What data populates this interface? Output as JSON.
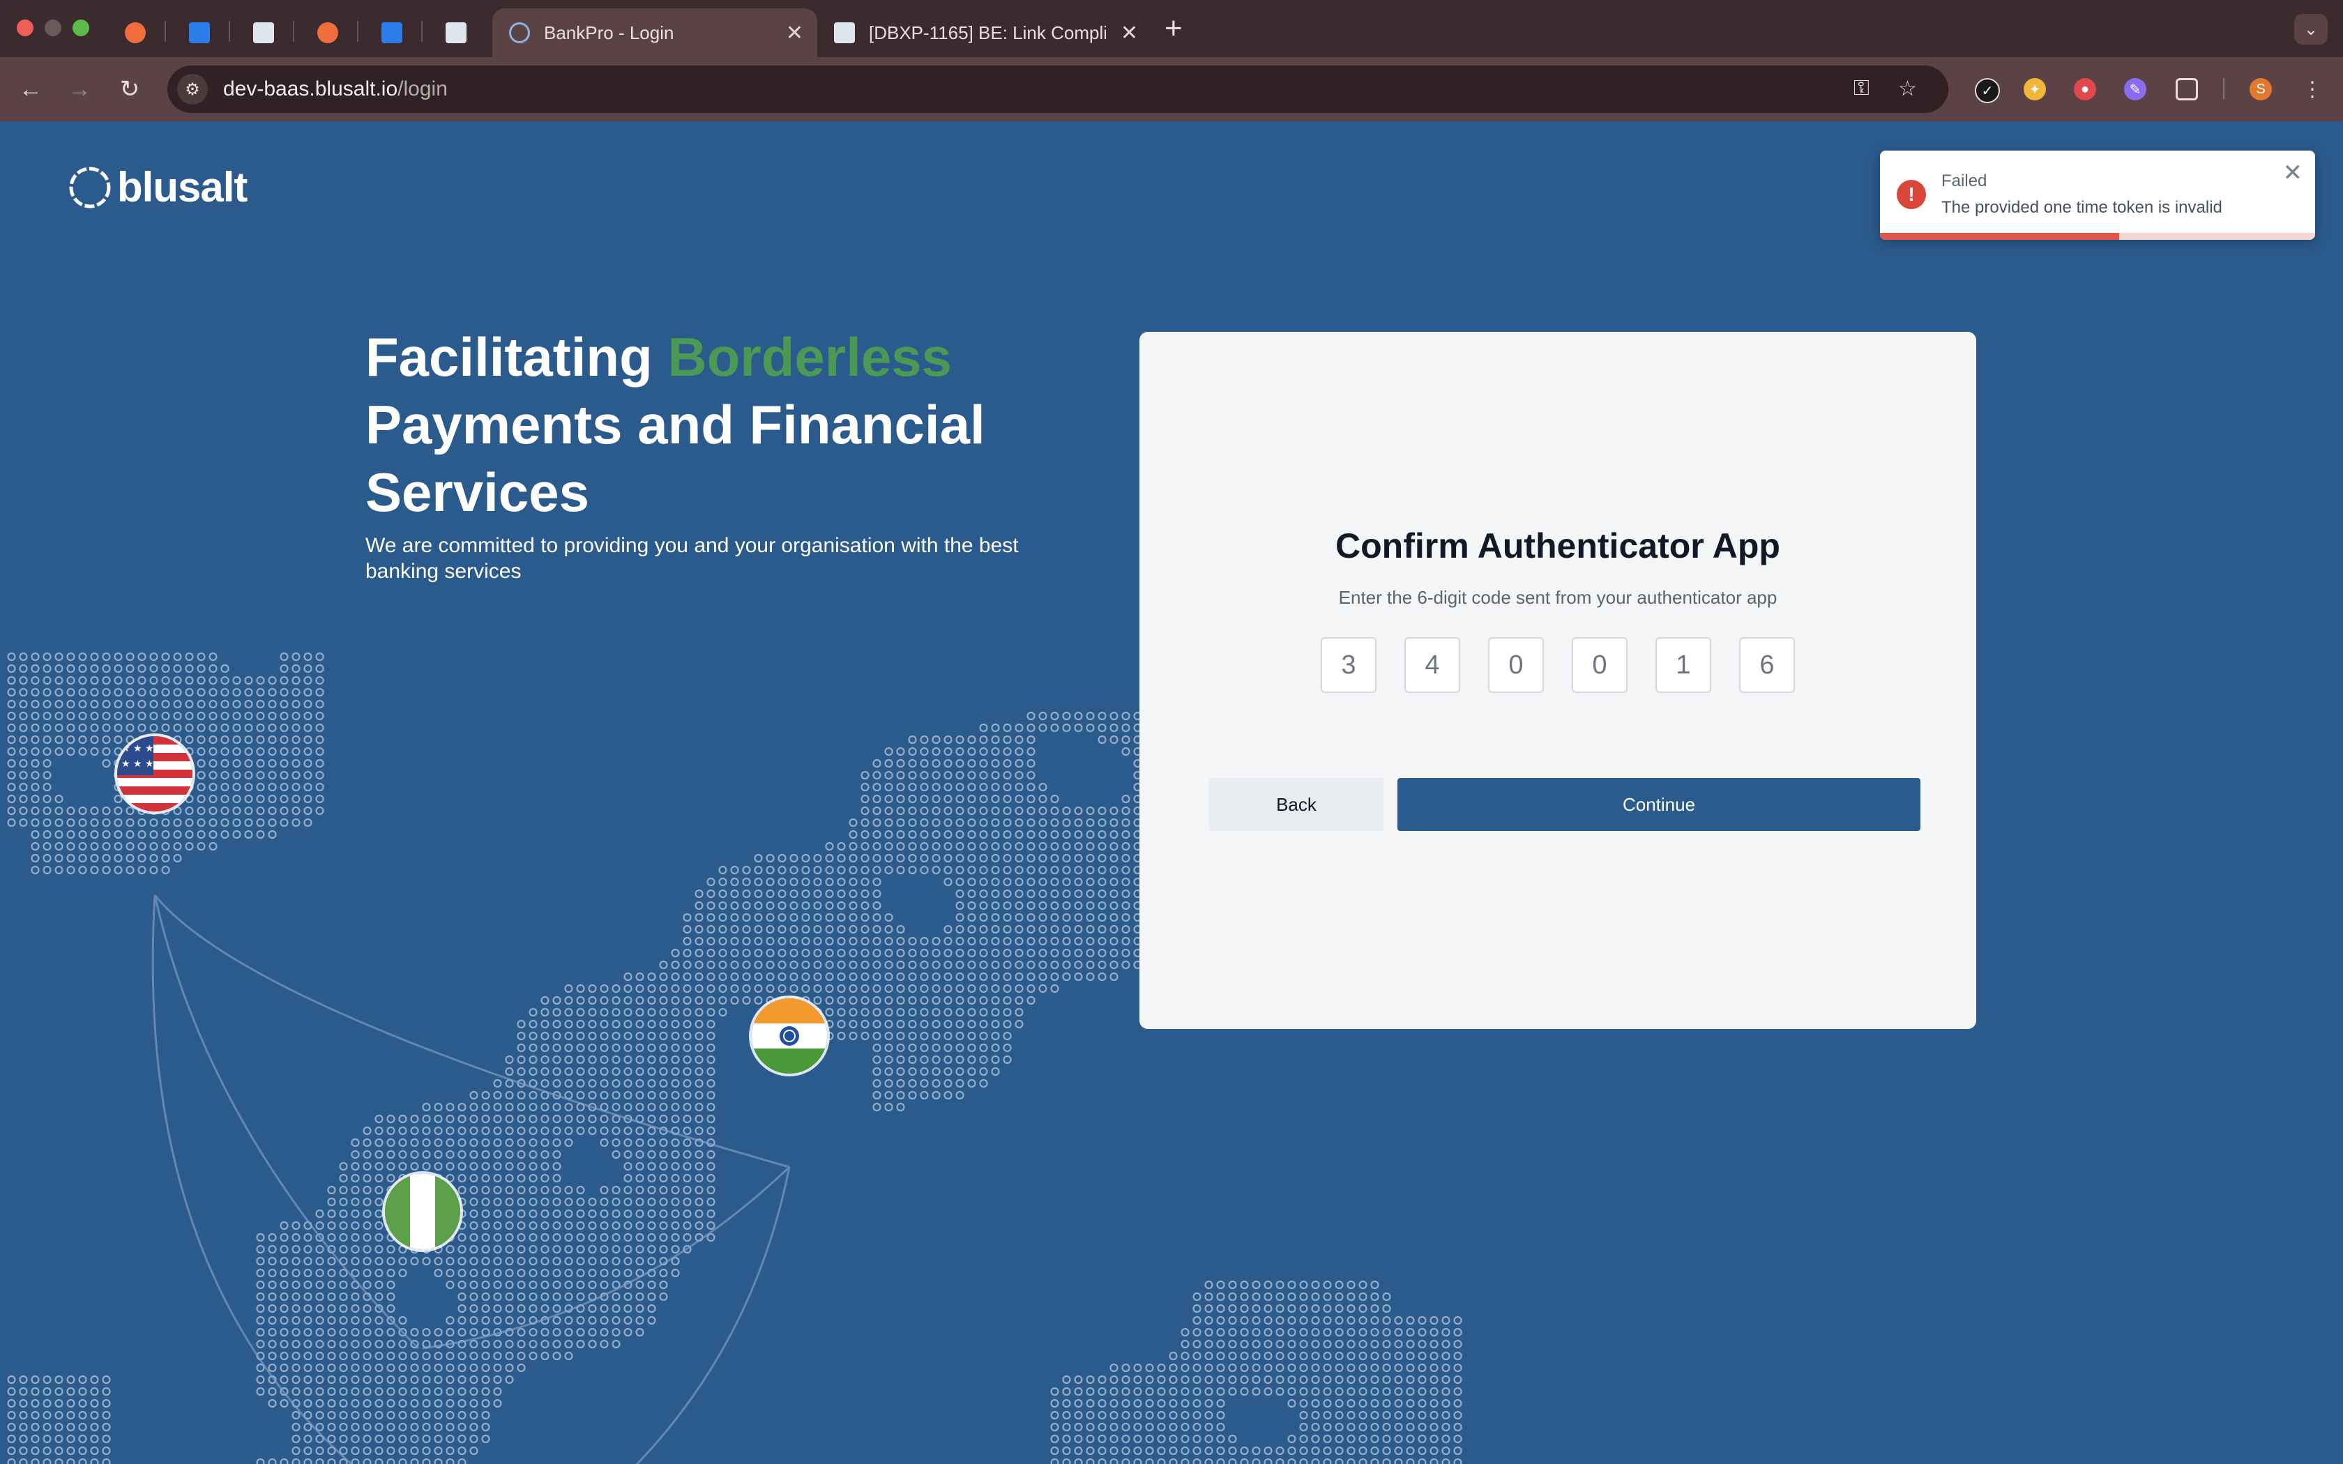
{
  "browser": {
    "tabs": [
      {
        "title": "BankPro - Login",
        "active": true
      },
      {
        "title": "[DBXP-1165] BE: Link Compli",
        "active": false
      }
    ],
    "url_host": "dev-baas.blusalt.io",
    "url_path": "/login",
    "profile_initial": "S",
    "icons": [
      "back-icon",
      "forward-icon",
      "reload-icon",
      "tune-icon",
      "key-icon",
      "star-icon",
      "puzzle-icon",
      "kebab-menu-icon",
      "new-tab-icon",
      "tab-search-icon"
    ]
  },
  "brand": {
    "name": "blusalt"
  },
  "hero": {
    "headline_prefix": "Facilitating ",
    "headline_accent": "Borderless",
    "headline_rest": "Payments and Financial Services",
    "subtext": "We are committed to providing you and your organisation with the best banking services",
    "accent_color": "#4a9a55"
  },
  "card": {
    "title": "Confirm Authenticator App",
    "subtitle": "Enter the 6-digit code sent from your authenticator app",
    "otp_digits": [
      "3",
      "4",
      "0",
      "0",
      "1",
      "6"
    ],
    "back_label": "Back",
    "continue_label": "Continue",
    "primary_color": "#2b5a8c"
  },
  "toast": {
    "title": "Failed",
    "message": "The provided one time token is invalid",
    "status_color": "#d9463a",
    "progress": 0.55
  }
}
